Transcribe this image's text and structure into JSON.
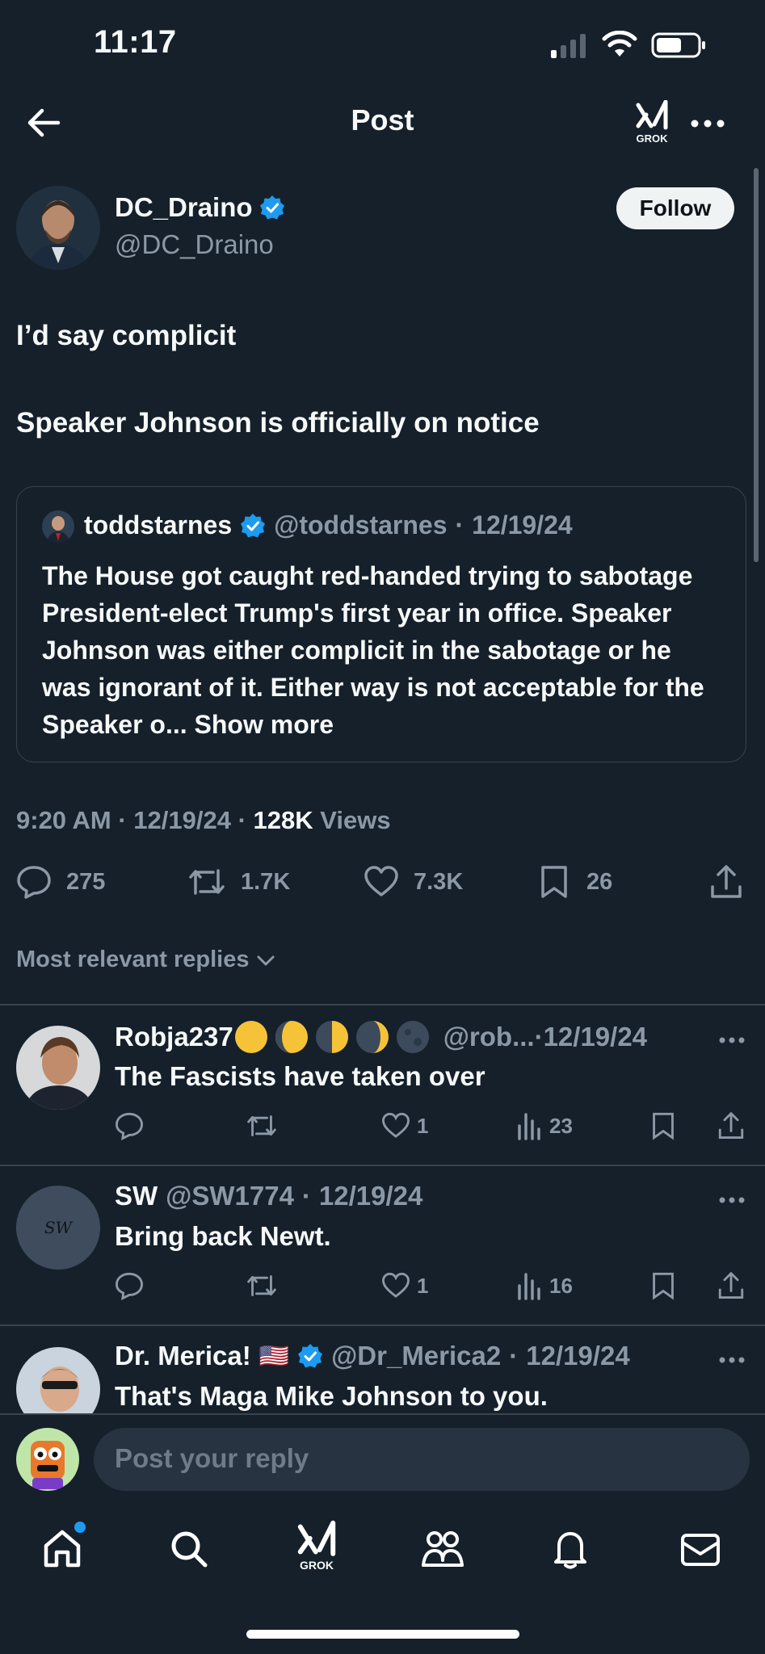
{
  "status_bar": {
    "time": "11:17"
  },
  "header": {
    "title": "Post",
    "grok_label": "GROK"
  },
  "post": {
    "author_name": "DC_Draino",
    "author_handle": "@DC_Draino",
    "follow_label": "Follow",
    "text_line1": "I’d say complicit",
    "text_line2": "Speaker Johnson is officially on notice",
    "quote": {
      "author_name": "toddstarnes",
      "author_handle": "@toddstarnes",
      "date": "12/19/24",
      "body": "The House got caught red-handed trying to sabotage President-elect Trump's first year in office. Speaker Johnson was either complicit in the sabotage or he was ignorant of it. Either way is not acceptable for the Speaker o...",
      "show_more": "Show more"
    },
    "meta": {
      "time": "9:20 AM",
      "date": "12/19/24",
      "views_count": "128K",
      "views_label": "Views"
    },
    "stats": {
      "replies": "275",
      "reposts": "1.7K",
      "likes": "7.3K",
      "bookmarks": "26"
    }
  },
  "replies_filter": "Most relevant replies",
  "replies": [
    {
      "name": "Robja237",
      "handle": "@rob...",
      "date": "12/19/24",
      "text": "The Fascists have taken over",
      "likes": "1",
      "views": "23"
    },
    {
      "name": "SW",
      "avatar_text": "SW",
      "handle": "@SW1774",
      "date": "12/19/24",
      "text": "Bring back Newt.",
      "likes": "1",
      "views": "16"
    },
    {
      "name": "Dr. Merica!",
      "flag": "🇺🇸",
      "handle": "@Dr_Merica2",
      "date": "12/19/24",
      "text": "That's Maga Mike Johnson to you."
    }
  ],
  "composer": {
    "placeholder": "Post your reply"
  },
  "bottom_nav": {
    "grok_label": "GROK"
  },
  "colors": {
    "background": "#15202b",
    "verified": "#1d9bf0",
    "muted": "#8b98a5",
    "divider": "#38444d"
  }
}
